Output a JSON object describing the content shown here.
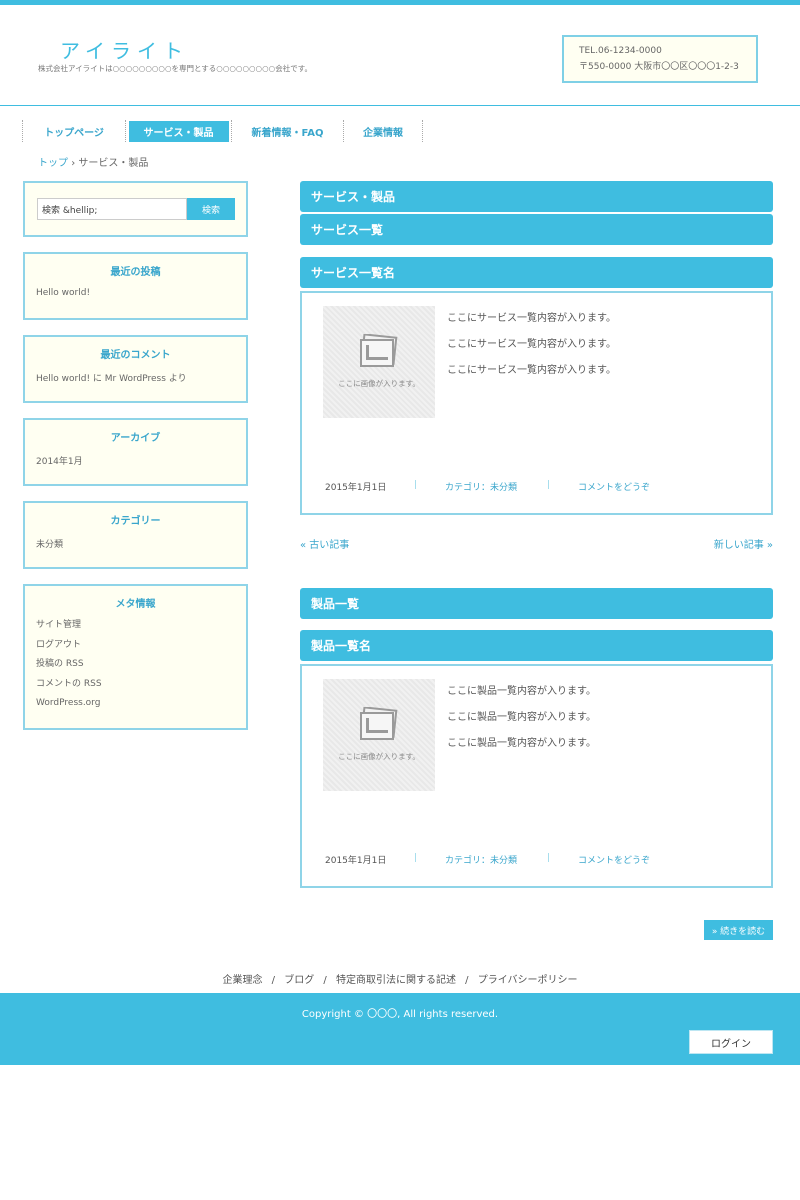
{
  "header": {
    "logo": "アイライト",
    "tagline": "株式会社アイライトは○○○○○○○○○を専門とする○○○○○○○○○会社です。",
    "tel": "TEL.06-1234-0000",
    "address": "〒550-0000 大阪市〇〇区〇〇〇1-2-3"
  },
  "nav": {
    "items": [
      {
        "label": "トップページ"
      },
      {
        "label": "サービス・製品"
      },
      {
        "label": "新着情報・FAQ"
      },
      {
        "label": "企業情報"
      }
    ],
    "active_index": 1
  },
  "breadcrumb": {
    "home": "トップ",
    "separator": "›",
    "current": "サービス・製品"
  },
  "sidebar": {
    "search": {
      "placeholder": "検索 &hellip;",
      "button": "検索"
    },
    "recent_posts": {
      "title": "最近の投稿",
      "items": [
        "Hello world!"
      ]
    },
    "recent_comments": {
      "title": "最近のコメント",
      "items": [
        "Hello world! に Mr WordPress より"
      ]
    },
    "archive": {
      "title": "アーカイブ",
      "items": [
        "2014年1月"
      ]
    },
    "categories": {
      "title": "カテゴリー",
      "items": [
        "未分類"
      ]
    },
    "meta": {
      "title": "メタ情報",
      "items": [
        "サイト管理",
        "ログアウト",
        "投稿の RSS",
        "コメントの RSS",
        "WordPress.org"
      ]
    }
  },
  "main": {
    "page_title": "サービス・製品",
    "services_heading": "サービス一覧",
    "services_item_heading": "サービス一覧名",
    "services_card": {
      "thumb_caption": "ここに画像が入ります。",
      "lines": [
        "ここにサービス一覧内容が入ります。",
        "ここにサービス一覧内容が入ります。",
        "ここにサービス一覧内容が入ります。"
      ],
      "date": "2015年1月1日",
      "category": "カテゴリ：未分類",
      "comment": "コメントをどうぞ",
      "sep": "|"
    },
    "pager": {
      "older": "« 古い記事",
      "newer": "新しい記事 »"
    },
    "products_heading": "製品一覧",
    "products_item_heading": "製品一覧名",
    "products_card": {
      "thumb_caption": "ここに画像が入ります。",
      "lines": [
        "ここに製品一覧内容が入ります。",
        "ここに製品一覧内容が入ります。",
        "ここに製品一覧内容が入ります。"
      ],
      "date": "2015年1月1日",
      "category": "カテゴリ：未分類",
      "comment": "コメントをどうぞ",
      "sep": "|"
    },
    "read_more": "» 続きを読む"
  },
  "footer": {
    "links": [
      "企業理念",
      "ブログ",
      "特定商取引法に関する記述",
      "プライバシーポリシー"
    ],
    "link_sep": "/",
    "copyright": "Copyright © 〇〇〇, All rights reserved.",
    "login": "ログイン"
  },
  "colors": {
    "accent": "#3fbde0",
    "border": "#8fd4e8",
    "widget_bg": "#fffff2"
  }
}
